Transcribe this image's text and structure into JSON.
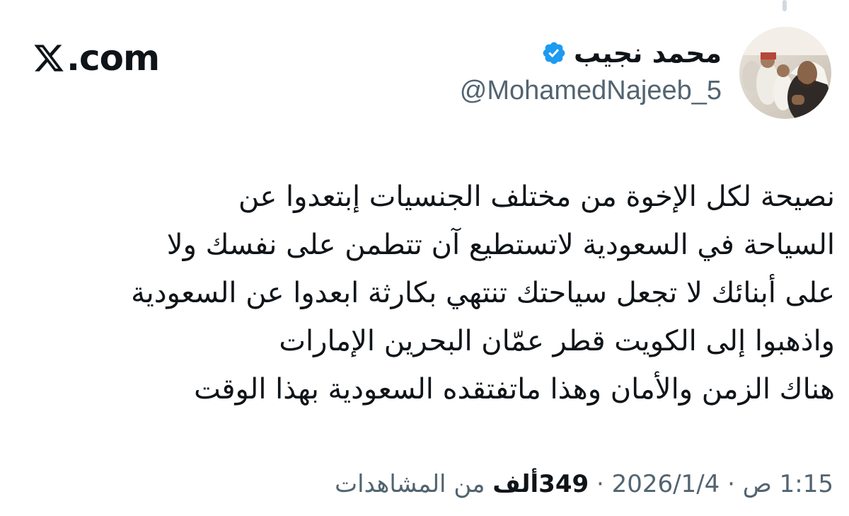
{
  "brand": {
    "label": ".com",
    "icon": "x-logo-icon"
  },
  "author": {
    "display_name": "محمد نجيب",
    "handle": "@MohamedNajeeb_5",
    "verified": true,
    "verified_color": "#1d9bf0",
    "avatar": "avatar-photo"
  },
  "tweet": {
    "lines": [
      "نصيحة لكل الإخوة من مختلف الجنسيات إبتعدوا عن",
      "السياحة في السعودية لاتستطيع آن تتطمن على نفسك ولا",
      "على أبنائك لا تجعل سياحتك تنتهي بكارثة ابعدوا عن السعودية",
      "واذهبوا إلى الكويت قطر عمّان البحرين الإمارات",
      "هناك الزمن والأمان وهذا ماتفتقده السعودية بهذا الوقت"
    ]
  },
  "meta": {
    "time": "1:15 ص",
    "separator": "·",
    "date": "2026/1/4",
    "views_count": "349ألف",
    "views_label": "من المشاهدات"
  },
  "colors": {
    "text": "#0f1419",
    "secondary": "#536471",
    "accent": "#1d9bf0"
  }
}
